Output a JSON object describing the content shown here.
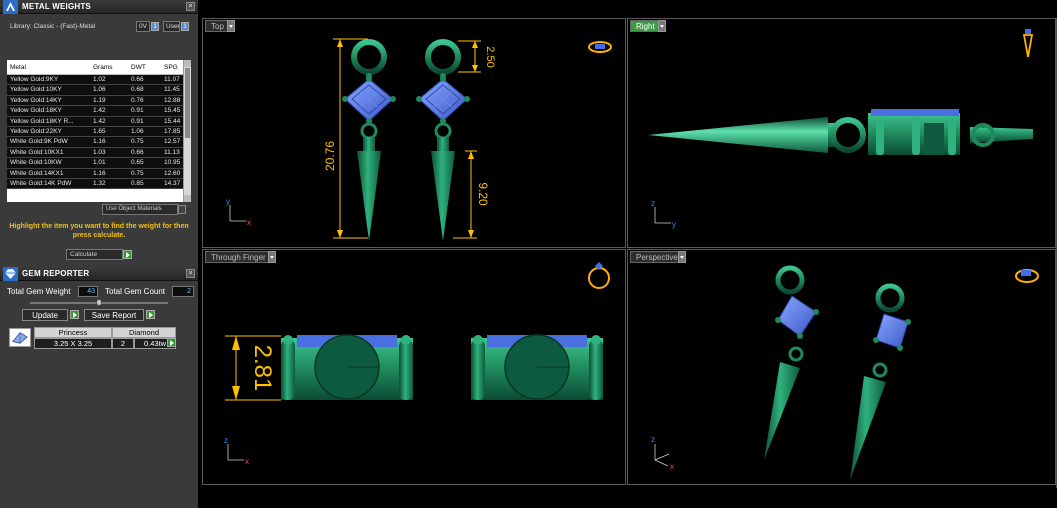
{
  "metal_weights": {
    "title": "METAL WEIGHTS",
    "library_label": "Library: Classic - (Fast)-Metal",
    "btn_0v": "0V",
    "btn_user": "User",
    "columns": [
      "Metal",
      "Grams",
      "DWT",
      "SPG"
    ],
    "rows": [
      [
        "Yellow Gold:9KY",
        "1.02",
        "0.66",
        "11.07"
      ],
      [
        "Yellow Gold:10KY",
        "1.06",
        "0.68",
        "11.45"
      ],
      [
        "Yellow Gold:14KY",
        "1.19",
        "0.76",
        "12.88"
      ],
      [
        "Yellow Gold:18KY",
        "1.42",
        "0.91",
        "15.45"
      ],
      [
        "Yellow Gold:18KY R...",
        "1.42",
        "0.91",
        "15.44"
      ],
      [
        "Yellow Gold:22KY",
        "1.65",
        "1.06",
        "17.85"
      ],
      [
        "White Gold:9K PdW",
        "1.16",
        "0.75",
        "12.57"
      ],
      [
        "White Gold:10KX1",
        "1.03",
        "0.66",
        "11.13"
      ],
      [
        "White Gold:10KW",
        "1.01",
        "0.65",
        "10.95"
      ],
      [
        "White Gold:14KX1",
        "1.16",
        "0.75",
        "12.60"
      ],
      [
        "White Gold:14K PdW",
        "1.32",
        "0.85",
        "14.37"
      ]
    ],
    "use_object_materials": "Use Object Materials",
    "hint": "Highlight the item you want to find the weight for then press calculate.",
    "calculate": "Calculate"
  },
  "gem_reporter": {
    "title": "GEM REPORTER",
    "total_weight_label": "Total Gem Weight",
    "total_weight_value": "43",
    "total_count_label": "Total Gem Count",
    "total_count_value": "2",
    "update": "Update",
    "save_report": "Save Report",
    "table": {
      "cut": "Princess",
      "type": "Diamond",
      "size": "3.25 X 3.25",
      "count": "2",
      "weight": "0.43tw"
    }
  },
  "viewports": {
    "top": {
      "label": "Top",
      "dims": {
        "total": "20.76",
        "loop": "2.50",
        "spike": "9.20"
      }
    },
    "right": {
      "label": "Right"
    },
    "through_finger": {
      "label": "Through Finger",
      "dims": {
        "height": "2.81"
      }
    },
    "perspective": {
      "label": "Perspective"
    }
  },
  "axes": {
    "x": "x",
    "y": "y",
    "z": "z"
  },
  "colors": {
    "metal_green": "#1f8a5e",
    "gem_blue": "#4a6fe0",
    "dimension_yellow": "#ffc000",
    "active_tab": "#3d9a47"
  }
}
